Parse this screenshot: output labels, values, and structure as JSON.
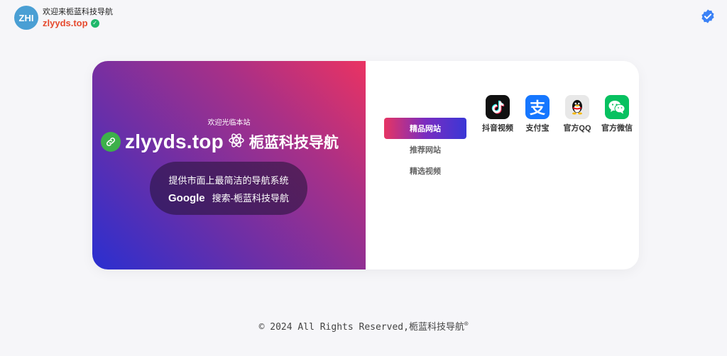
{
  "header": {
    "logo_text": "ZHI",
    "welcome": "欢迎来栀蓝科技导航",
    "domain": "zlyyds.top",
    "verified_icon": "check-circle-icon",
    "badge_icon": "verified-badge-icon"
  },
  "hero": {
    "welcome": "欢迎光临本站",
    "domain": "zlyyds.top",
    "name": "栀蓝科技导航",
    "tagline": "提供市面上最简洁的导航系统",
    "google": "Google",
    "search_text": "搜索-栀蓝科技导航",
    "link_icon": "link-icon",
    "atom_icon": "atom-icon"
  },
  "tabs": [
    {
      "label": "精品网站",
      "active": true
    },
    {
      "label": "推荐网站",
      "active": false
    },
    {
      "label": "精选视频",
      "active": false
    }
  ],
  "apps": [
    {
      "label": "抖音视频",
      "icon": "tiktok-icon"
    },
    {
      "label": "支付宝",
      "icon": "alipay-icon"
    },
    {
      "label": "官方QQ",
      "icon": "qq-icon"
    },
    {
      "label": "官方微信",
      "icon": "wechat-icon"
    }
  ],
  "footer": {
    "text": "© 2024 All Rights Reserved,栀蓝科技导航",
    "mark": "®"
  },
  "colors": {
    "accent_red": "#e64a2e",
    "gradient_start": "#2a2fd0",
    "gradient_end": "#ea3362"
  }
}
